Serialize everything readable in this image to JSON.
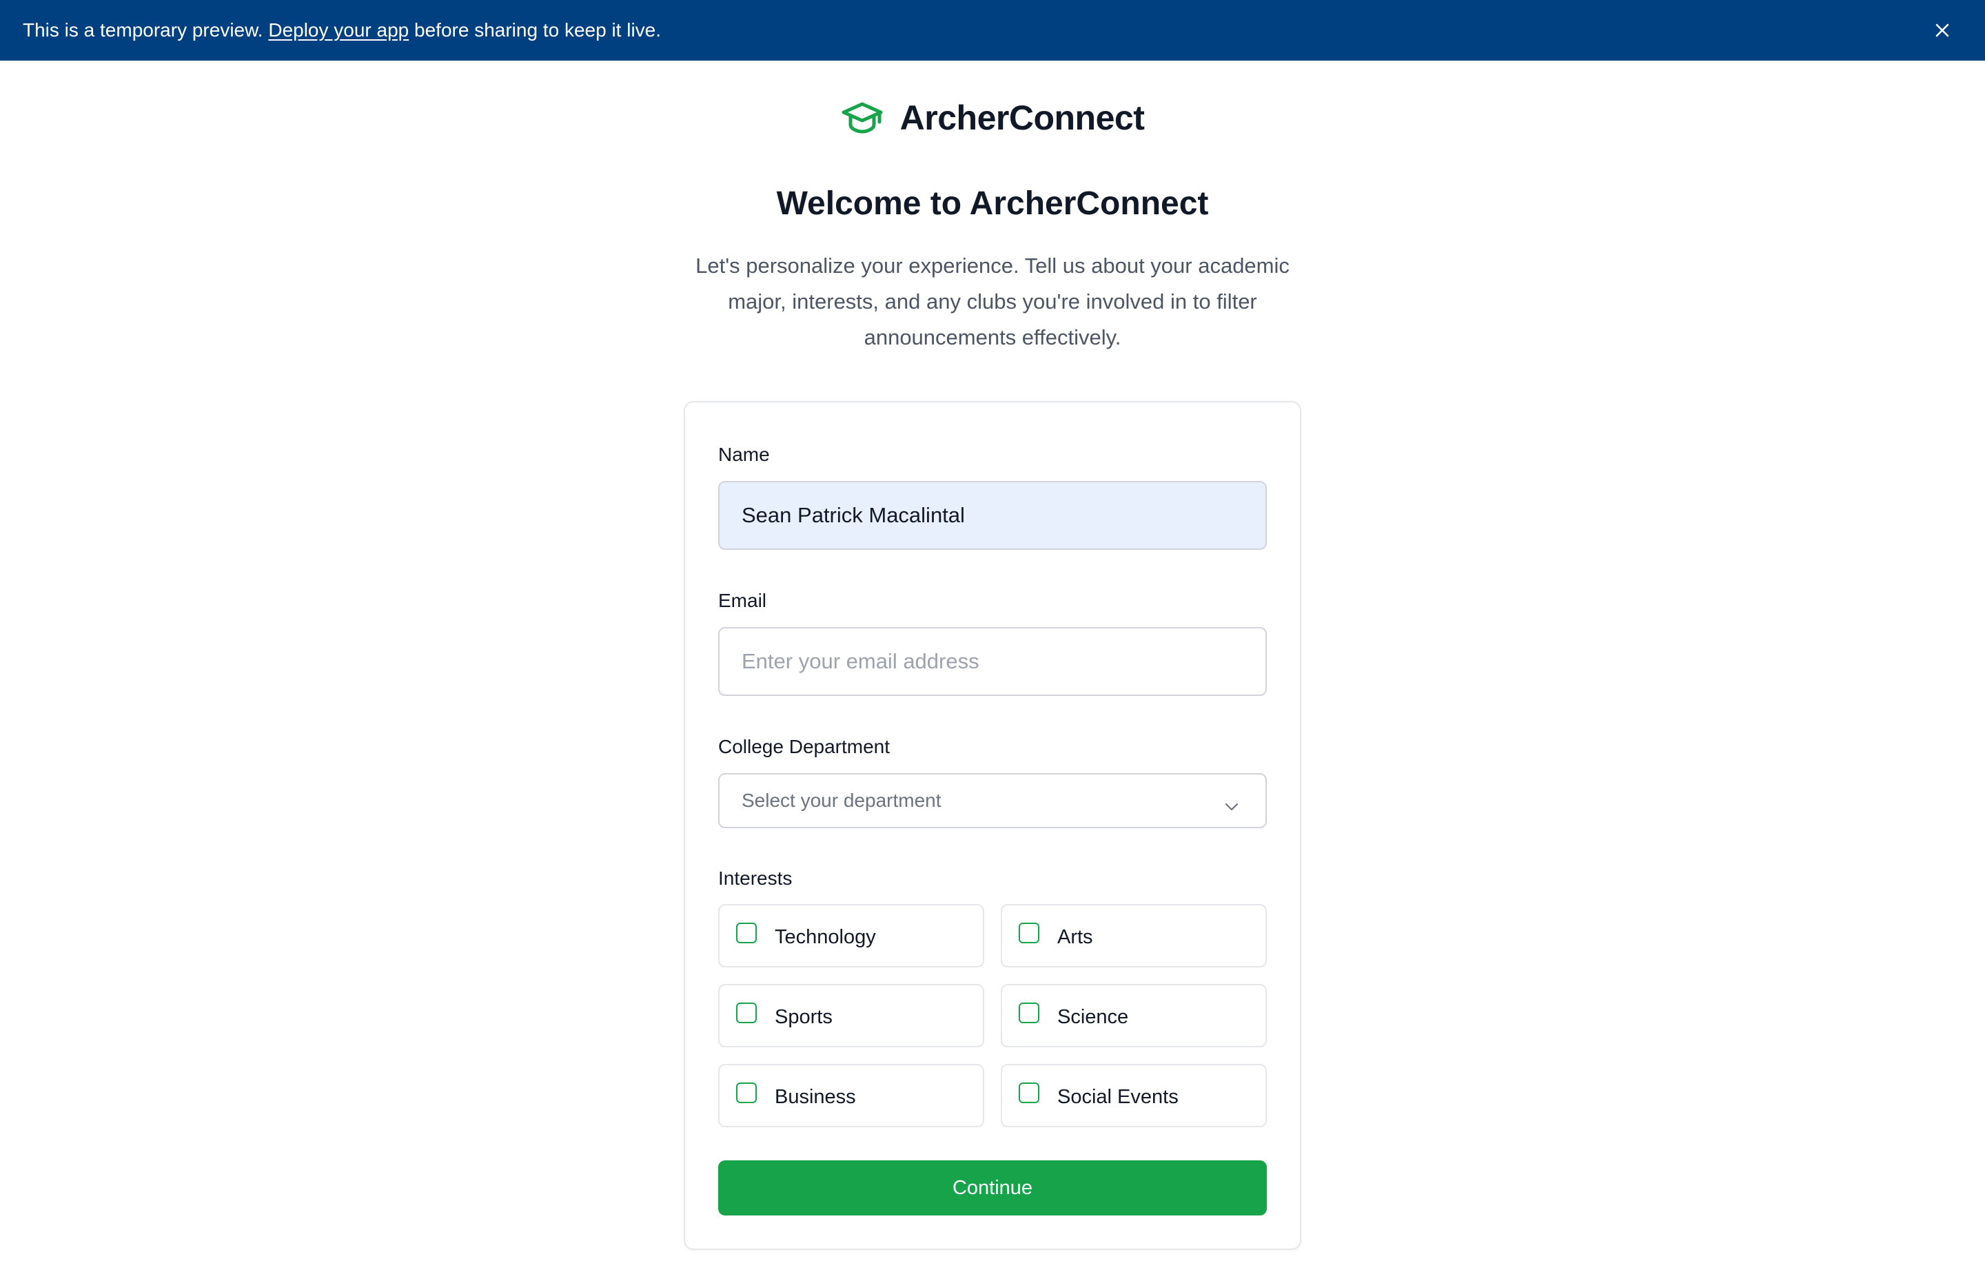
{
  "banner": {
    "text_before": "This is a temporary preview. ",
    "link_text": "Deploy your app",
    "text_after": " before sharing to keep it live.",
    "close_icon": "close-icon",
    "background_color": "#004080"
  },
  "brand": {
    "name": "ArcherConnect",
    "icon": "graduation-cap-icon",
    "accent_color": "#16a34a"
  },
  "welcome": {
    "title": "Welcome to ArcherConnect",
    "subtitle": "Let's personalize your experience. Tell us about your academic major, interests, and any clubs you're involved in to filter announcements effectively."
  },
  "form": {
    "name_label": "Name",
    "name_value": "Sean Patrick Macalintal",
    "email_label": "Email",
    "email_placeholder": "Enter your email address",
    "department_label": "College Department",
    "department_placeholder": "Select your department",
    "department_icon": "chevron-down-icon",
    "interests_label": "Interests",
    "interests": [
      {
        "label": "Technology",
        "checked": false
      },
      {
        "label": "Arts",
        "checked": false
      },
      {
        "label": "Sports",
        "checked": false
      },
      {
        "label": "Science",
        "checked": false
      },
      {
        "label": "Business",
        "checked": false
      },
      {
        "label": "Social Events",
        "checked": false
      }
    ],
    "continue_label": "Continue",
    "button_color": "#16a34a"
  }
}
